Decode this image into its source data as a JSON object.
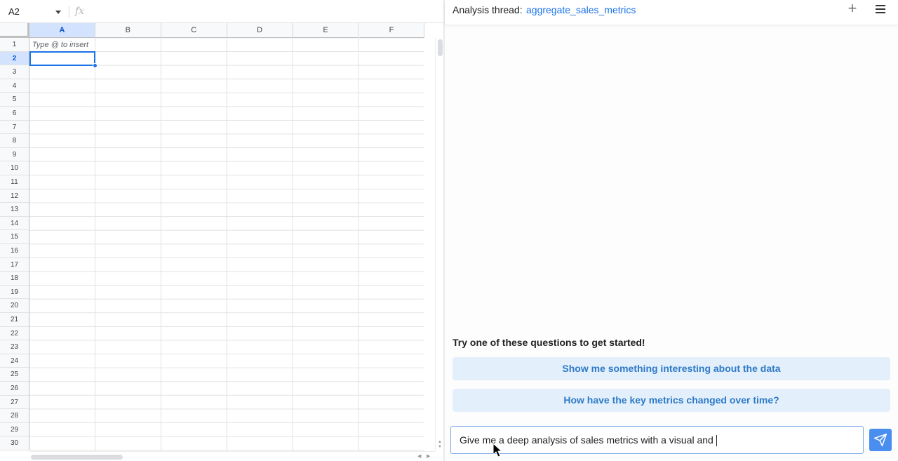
{
  "sheet": {
    "name_box": "A2",
    "fx_icon": "function-icon",
    "columns": [
      "A",
      "B",
      "C",
      "D",
      "E",
      "F"
    ],
    "selected_column": "A",
    "rows": [
      "1",
      "2",
      "3",
      "4",
      "5",
      "6",
      "7",
      "8",
      "9",
      "10",
      "11",
      "12",
      "13",
      "14",
      "15",
      "16",
      "17",
      "18",
      "19",
      "20",
      "21",
      "22",
      "23",
      "24",
      "25",
      "26",
      "27",
      "28",
      "29",
      "30"
    ],
    "selected_row": "2",
    "cell_a1_hint": "Type @ to insert",
    "selection_color": "#1a73e8"
  },
  "panel": {
    "thread_label": "Analysis thread:",
    "thread_name": "aggregate_sales_metrics",
    "new_thread_icon": "plus-icon",
    "menu_icon": "hamburger-menu-icon",
    "suggest_title": "Try one of these questions to get started!",
    "suggestions": [
      "Show me something interesting about the data",
      "How have the key metrics changed over time?"
    ],
    "prompt_value": "Give me a deep analysis of sales metrics with a visual and",
    "send_icon": "send-icon",
    "accent_color": "#4a8ef0"
  }
}
